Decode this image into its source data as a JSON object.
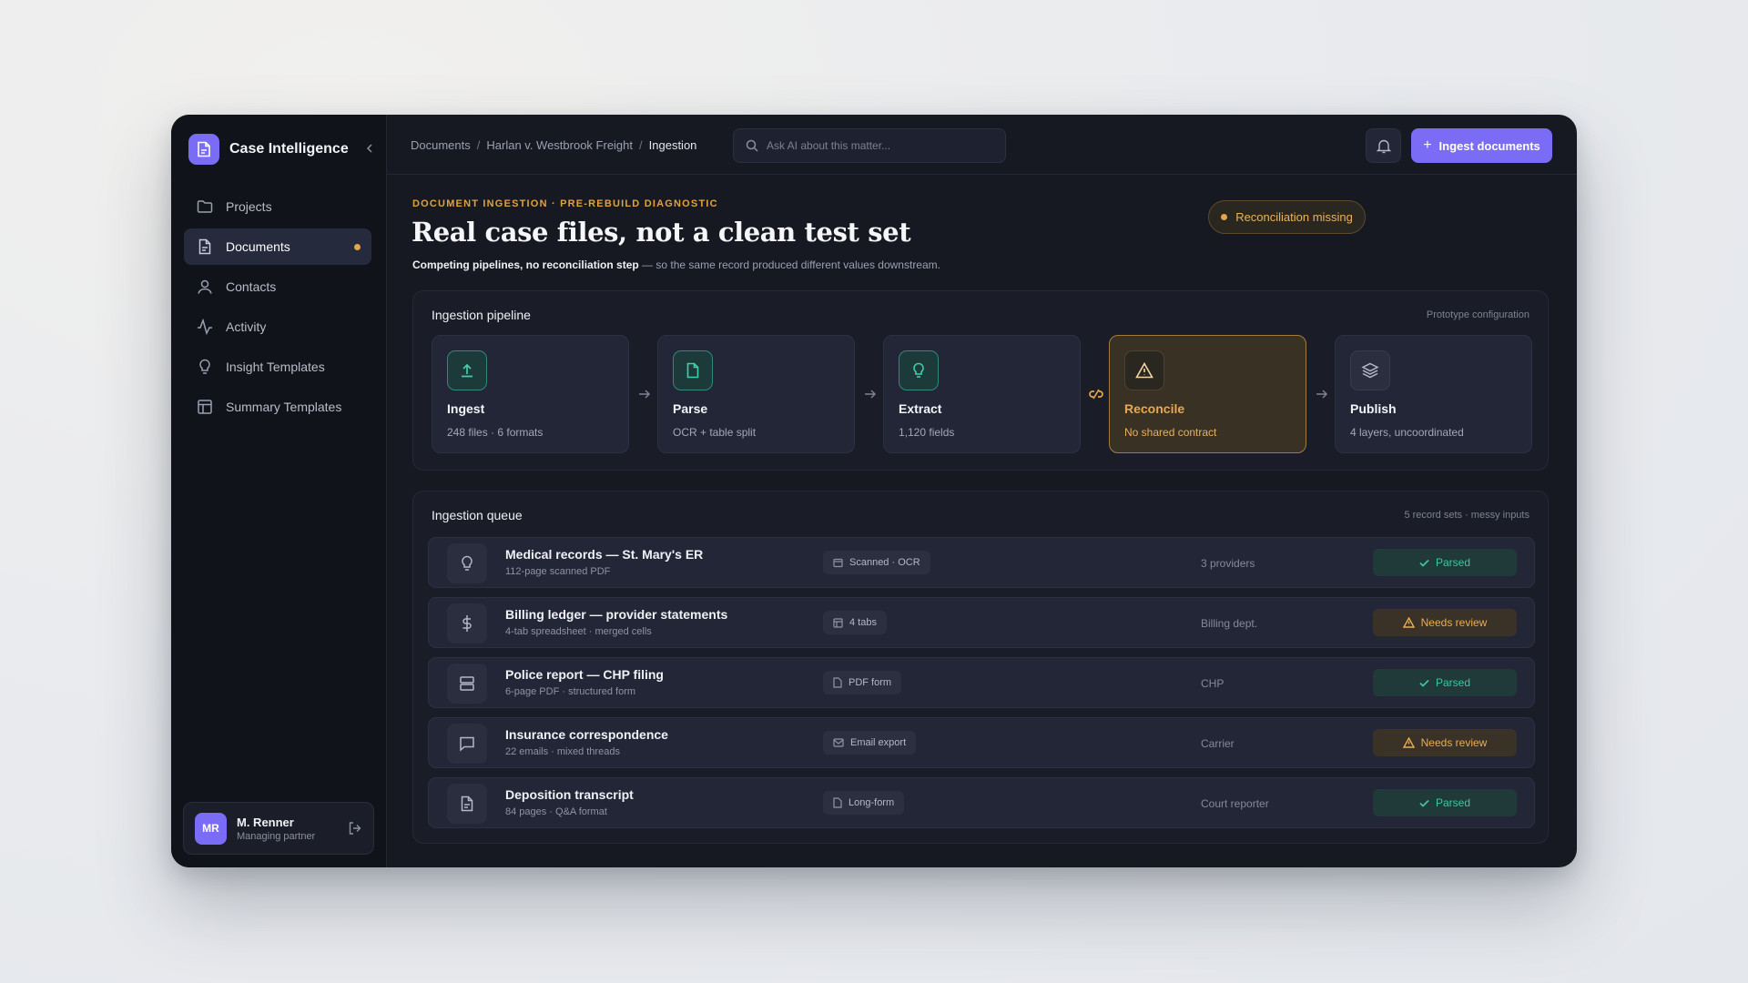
{
  "app": {
    "name": "Case Intelligence"
  },
  "sidebar": {
    "items": [
      {
        "label": "Projects",
        "icon": "folder-icon"
      },
      {
        "label": "Documents",
        "icon": "document-icon",
        "active": true,
        "dot": true
      },
      {
        "label": "Contacts",
        "icon": "user-icon"
      },
      {
        "label": "Activity",
        "icon": "activity-icon"
      },
      {
        "label": "Insight Templates",
        "icon": "lightbulb-icon"
      },
      {
        "label": "Summary Templates",
        "icon": "layout-icon"
      }
    ],
    "user": {
      "initials": "MR",
      "name": "M. Renner",
      "role": "Managing partner"
    }
  },
  "topbar": {
    "breadcrumbs": [
      "Documents",
      "Harlan v. Westbrook Freight",
      "Ingestion"
    ],
    "search_placeholder": "Ask AI about this matter...",
    "primary_button": "Ingest documents"
  },
  "header": {
    "eyebrow": "DOCUMENT INGESTION · PRE-REBUILD DIAGNOSTIC",
    "title": "Real case files, not a clean test set",
    "subtitle_bold": "Competing pipelines, no reconciliation step",
    "subtitle_rest": " — so the same record produced different values downstream.",
    "status": "Reconciliation missing"
  },
  "pipeline": {
    "title": "Ingestion pipeline",
    "meta": "Prototype configuration",
    "stages": [
      {
        "name": "Ingest",
        "meta": "248 files · 6 formats",
        "icon": "upload-icon",
        "state": "ok"
      },
      {
        "name": "Parse",
        "meta": "OCR + table split",
        "icon": "file-icon",
        "state": "ok"
      },
      {
        "name": "Extract",
        "meta": "1,120 fields",
        "icon": "lightbulb-icon",
        "state": "ok"
      },
      {
        "name": "Reconcile",
        "meta": "No shared contract",
        "icon": "warning-icon",
        "state": "warn"
      },
      {
        "name": "Publish",
        "meta": "4 layers, uncoordinated",
        "icon": "layers-icon",
        "state": "muted"
      }
    ]
  },
  "queue": {
    "title": "Ingestion queue",
    "meta": "5 record sets · messy inputs",
    "rows": [
      {
        "title": "Medical records — St. Mary's ER",
        "sub": "112-page scanned PDF",
        "tag": "Scanned · OCR",
        "source": "3 providers",
        "status": "Parsed",
        "icon": "lightbulb-icon"
      },
      {
        "title": "Billing ledger — provider statements",
        "sub": "4-tab spreadsheet · merged cells",
        "tag": "4 tabs",
        "source": "Billing dept.",
        "status": "Needs review",
        "icon": "dollar-icon"
      },
      {
        "title": "Police report — CHP filing",
        "sub": "6-page PDF · structured form",
        "tag": "PDF form",
        "source": "CHP",
        "status": "Parsed",
        "icon": "form-icon"
      },
      {
        "title": "Insurance correspondence",
        "sub": "22 emails · mixed threads",
        "tag": "Email export",
        "source": "Carrier",
        "status": "Needs review",
        "icon": "message-icon"
      },
      {
        "title": "Deposition transcript",
        "sub": "84 pages · Q&A format",
        "tag": "Long-form",
        "source": "Court reporter",
        "status": "Parsed",
        "icon": "file-text-icon"
      }
    ]
  }
}
